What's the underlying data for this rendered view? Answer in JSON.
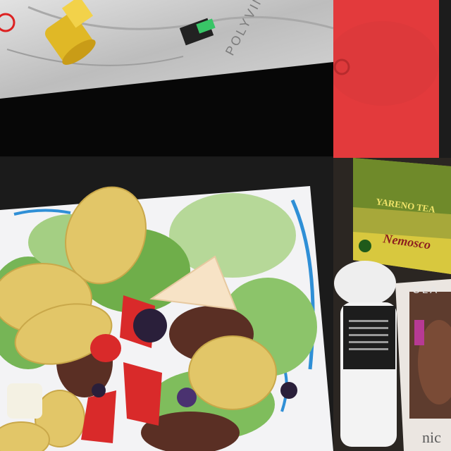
{
  "collage": {
    "tiles": [
      {
        "subject": "plastic bag with yellow plastic valve fitting"
      },
      {
        "subject": "red surface"
      },
      {
        "subject": "salad bowl with lettuce, potato chips, tomatoes, apple, berries, ground meat"
      },
      {
        "subject": "herbal tea box, white bottle with black label, hair dye box"
      }
    ]
  },
  "bag_tile": {
    "printed_text": "POLYVIN C"
  },
  "products_tile": {
    "tea_box_text": "YARENO TEA",
    "tea_box_brand": "Nemosco",
    "hair_dye_brand": "CLA",
    "hair_dye_shade": "nic"
  },
  "colors": {
    "bag": "#cfcfcf",
    "valve": "#e8c02a",
    "red_surface": "#e33a3c",
    "lettuce": "#8cc46a",
    "chip": "#e2c668",
    "tomato": "#d92a2a",
    "bowl_accent": "#2f8fd6",
    "tea_box": "#a7a83a",
    "dye_box": "#5e3c2e"
  }
}
